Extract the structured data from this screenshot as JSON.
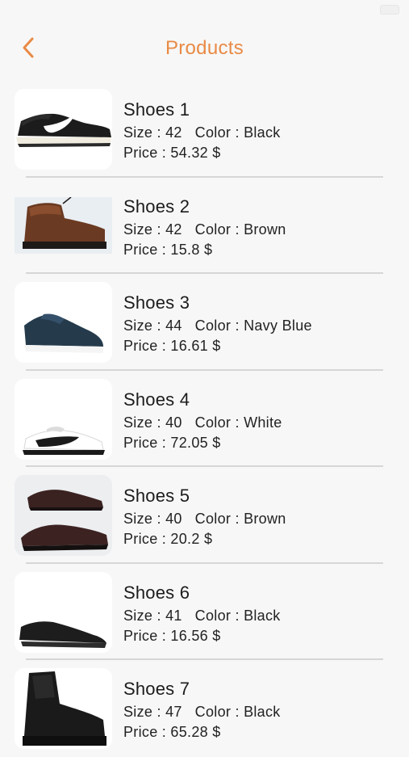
{
  "nav": {
    "title": "Products",
    "back_icon": "chevron-left-icon",
    "accent_color": "#e98a45"
  },
  "products": [
    {
      "name": "Shoes 1",
      "size_label": "Size : 42",
      "color_label": "Color : Black",
      "price_label": "Price : 54.32 $",
      "image": "black-white-running-sneaker"
    },
    {
      "name": "Shoes 2",
      "size_label": "Size : 42",
      "color_label": "Color : Brown",
      "price_label": "Price : 15.8 $",
      "image": "brown-leather-boot"
    },
    {
      "name": "Shoes 3",
      "size_label": "Size : 44",
      "color_label": "Color : Navy Blue",
      "price_label": "Price : 16.61 $",
      "image": "navy-blue-sneaker"
    },
    {
      "name": "Shoes 4",
      "size_label": "Size : 40",
      "color_label": "Color : White",
      "price_label": "Price : 72.05 $",
      "image": "white-black-sneaker"
    },
    {
      "name": "Shoes 5",
      "size_label": "Size : 40",
      "color_label": "Color : Brown",
      "price_label": "Price : 20.2 $",
      "image": "brown-leather-shoes-pair"
    },
    {
      "name": "Shoes 6",
      "size_label": "Size : 41",
      "color_label": "Color : Black",
      "price_label": "Price : 16.56 $",
      "image": "black-sneaker"
    },
    {
      "name": "Shoes 7",
      "size_label": "Size : 47",
      "color_label": "Color : Black",
      "price_label": "Price : 65.28 $",
      "image": "black-boot"
    }
  ]
}
